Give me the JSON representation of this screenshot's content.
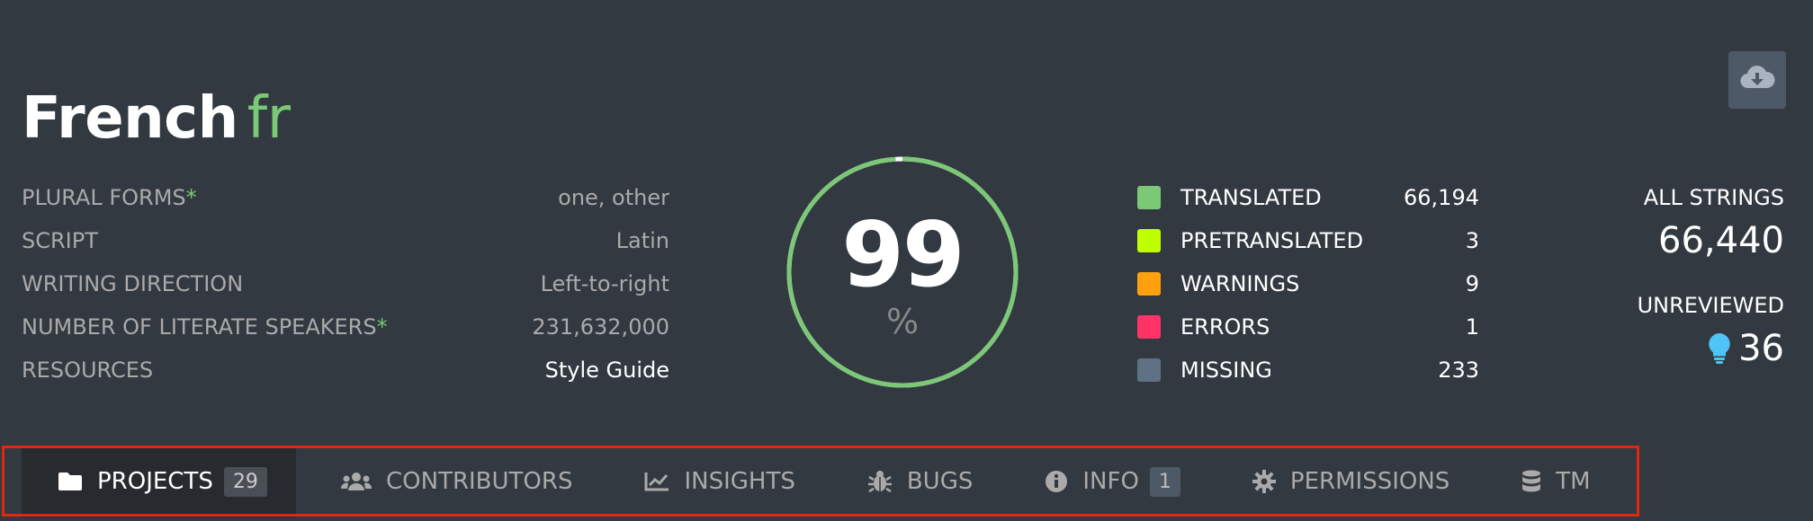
{
  "header": {
    "title": "French",
    "code": "fr",
    "download_icon": "cloud-download-icon"
  },
  "info": [
    {
      "label": "Plural forms",
      "asterisk": "*",
      "value": "one, other"
    },
    {
      "label": "Script",
      "asterisk": "",
      "value": "Latin"
    },
    {
      "label": "Writing direction",
      "asterisk": "",
      "value": "Left-to-right"
    },
    {
      "label": "Number of literate speakers",
      "asterisk": "*",
      "value": "231,632,000"
    },
    {
      "label": "Resources",
      "asterisk": "",
      "value": "Style Guide"
    }
  ],
  "progress": {
    "percent": "99",
    "unit": "%",
    "color": "#7bc876"
  },
  "legend": [
    {
      "label": "Translated",
      "value": "66,194",
      "color": "#7bc876"
    },
    {
      "label": "Pretranslated",
      "value": "3",
      "color": "#c0ff00"
    },
    {
      "label": "Warnings",
      "value": "9",
      "color": "#ffa10f"
    },
    {
      "label": "Errors",
      "value": "1",
      "color": "#ff3367"
    },
    {
      "label": "Missing",
      "value": "233",
      "color": "#5f7285"
    }
  ],
  "stats": {
    "all_strings_label": "All strings",
    "all_strings_value": "66,440",
    "unreviewed_label": "Unreviewed",
    "unreviewed_value": "36",
    "unreviewed_icon": "lightbulb-icon"
  },
  "tabs": [
    {
      "label": "Projects",
      "count": "29",
      "icon": "folder-icon",
      "active": true
    },
    {
      "label": "Contributors",
      "count": "",
      "icon": "users-icon",
      "active": false
    },
    {
      "label": "Insights",
      "count": "",
      "icon": "chart-line-icon",
      "active": false
    },
    {
      "label": "Bugs",
      "count": "",
      "icon": "bug-icon",
      "active": false
    },
    {
      "label": "Info",
      "count": "1",
      "icon": "info-circle-icon",
      "active": false
    },
    {
      "label": "Permissions",
      "count": "",
      "icon": "gear-icon",
      "active": false
    },
    {
      "label": "TM",
      "count": "",
      "icon": "database-icon",
      "active": false
    }
  ],
  "colors": {
    "background": "#333941",
    "accent": "#7bc876",
    "highlight_border": "#e0280e"
  }
}
